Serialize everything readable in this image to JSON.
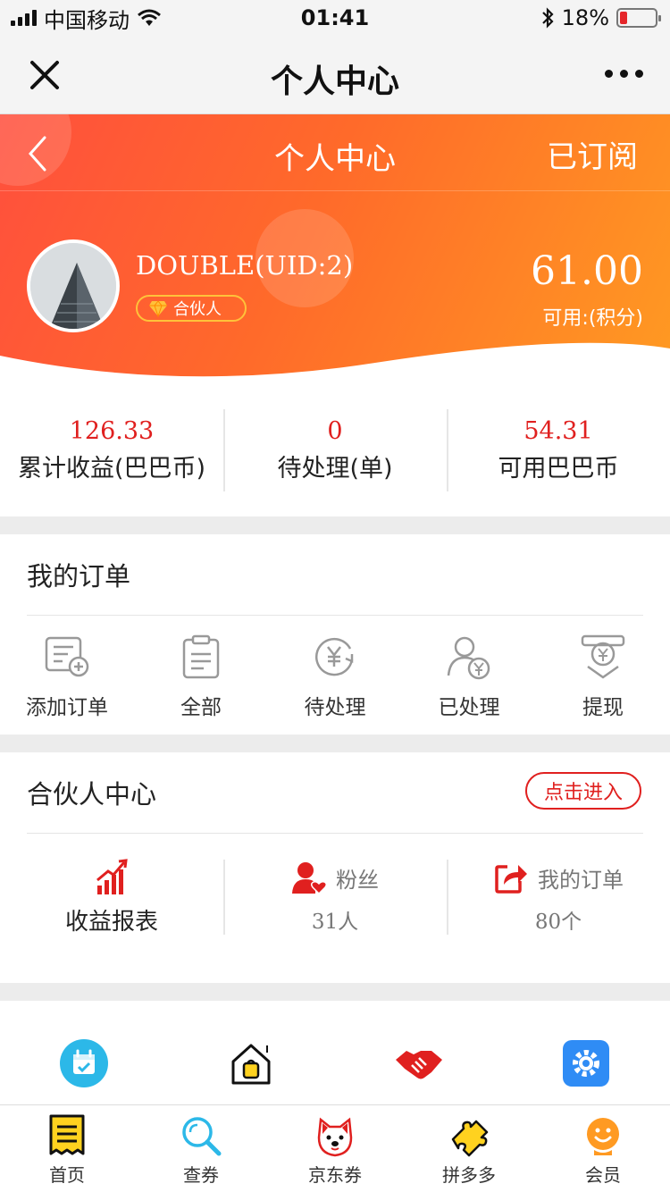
{
  "status_bar": {
    "carrier": "中国移动",
    "time": "01:41",
    "battery": "18%"
  },
  "wechat_nav": {
    "title": "个人中心"
  },
  "header": {
    "title": "个人中心",
    "subscribed_label": "已订阅"
  },
  "profile": {
    "username": "DOUBLE(UID:2)",
    "badge": "合伙人",
    "points": "61.00",
    "points_label": "可用:(积分)"
  },
  "stats": [
    {
      "value": "126.33",
      "label": "累计收益(巴巴币)"
    },
    {
      "value": "0",
      "label": "待处理(单)"
    },
    {
      "value": "54.31",
      "label": "可用巴巴币"
    }
  ],
  "orders": {
    "title": "我的订单",
    "items": [
      {
        "label": "添加订单",
        "icon": "add-order-icon"
      },
      {
        "label": "全部",
        "icon": "clipboard-icon"
      },
      {
        "label": "待处理",
        "icon": "yuan-refresh-icon"
      },
      {
        "label": "已处理",
        "icon": "user-yuan-icon"
      },
      {
        "label": "提现",
        "icon": "withdraw-icon"
      }
    ]
  },
  "partner": {
    "title": "合伙人中心",
    "enter_label": "点击进入",
    "report_label": "收益报表",
    "fans_label": "粉丝",
    "fans_count": "31人",
    "my_orders_label": "我的订单",
    "my_orders_count": "80个"
  },
  "tools": {
    "items": [
      {
        "icon": "calendar-icon"
      },
      {
        "icon": "shop-icon"
      },
      {
        "icon": "handshake-icon"
      },
      {
        "icon": "settings-gear-icon"
      }
    ]
  },
  "tabbar": {
    "items": [
      {
        "label": "首页",
        "icon": "home-receipt-icon"
      },
      {
        "label": "查券",
        "icon": "search-icon"
      },
      {
        "label": "京东券",
        "icon": "dog-icon"
      },
      {
        "label": "拼多多",
        "icon": "puzzle-icon"
      },
      {
        "label": "会员",
        "icon": "member-face-icon"
      }
    ]
  },
  "colors": {
    "accent_red": "#e0201f",
    "hero_start": "#ff4f3d",
    "hero_end": "#ff9a22",
    "badge_gold": "#ffc23a"
  }
}
